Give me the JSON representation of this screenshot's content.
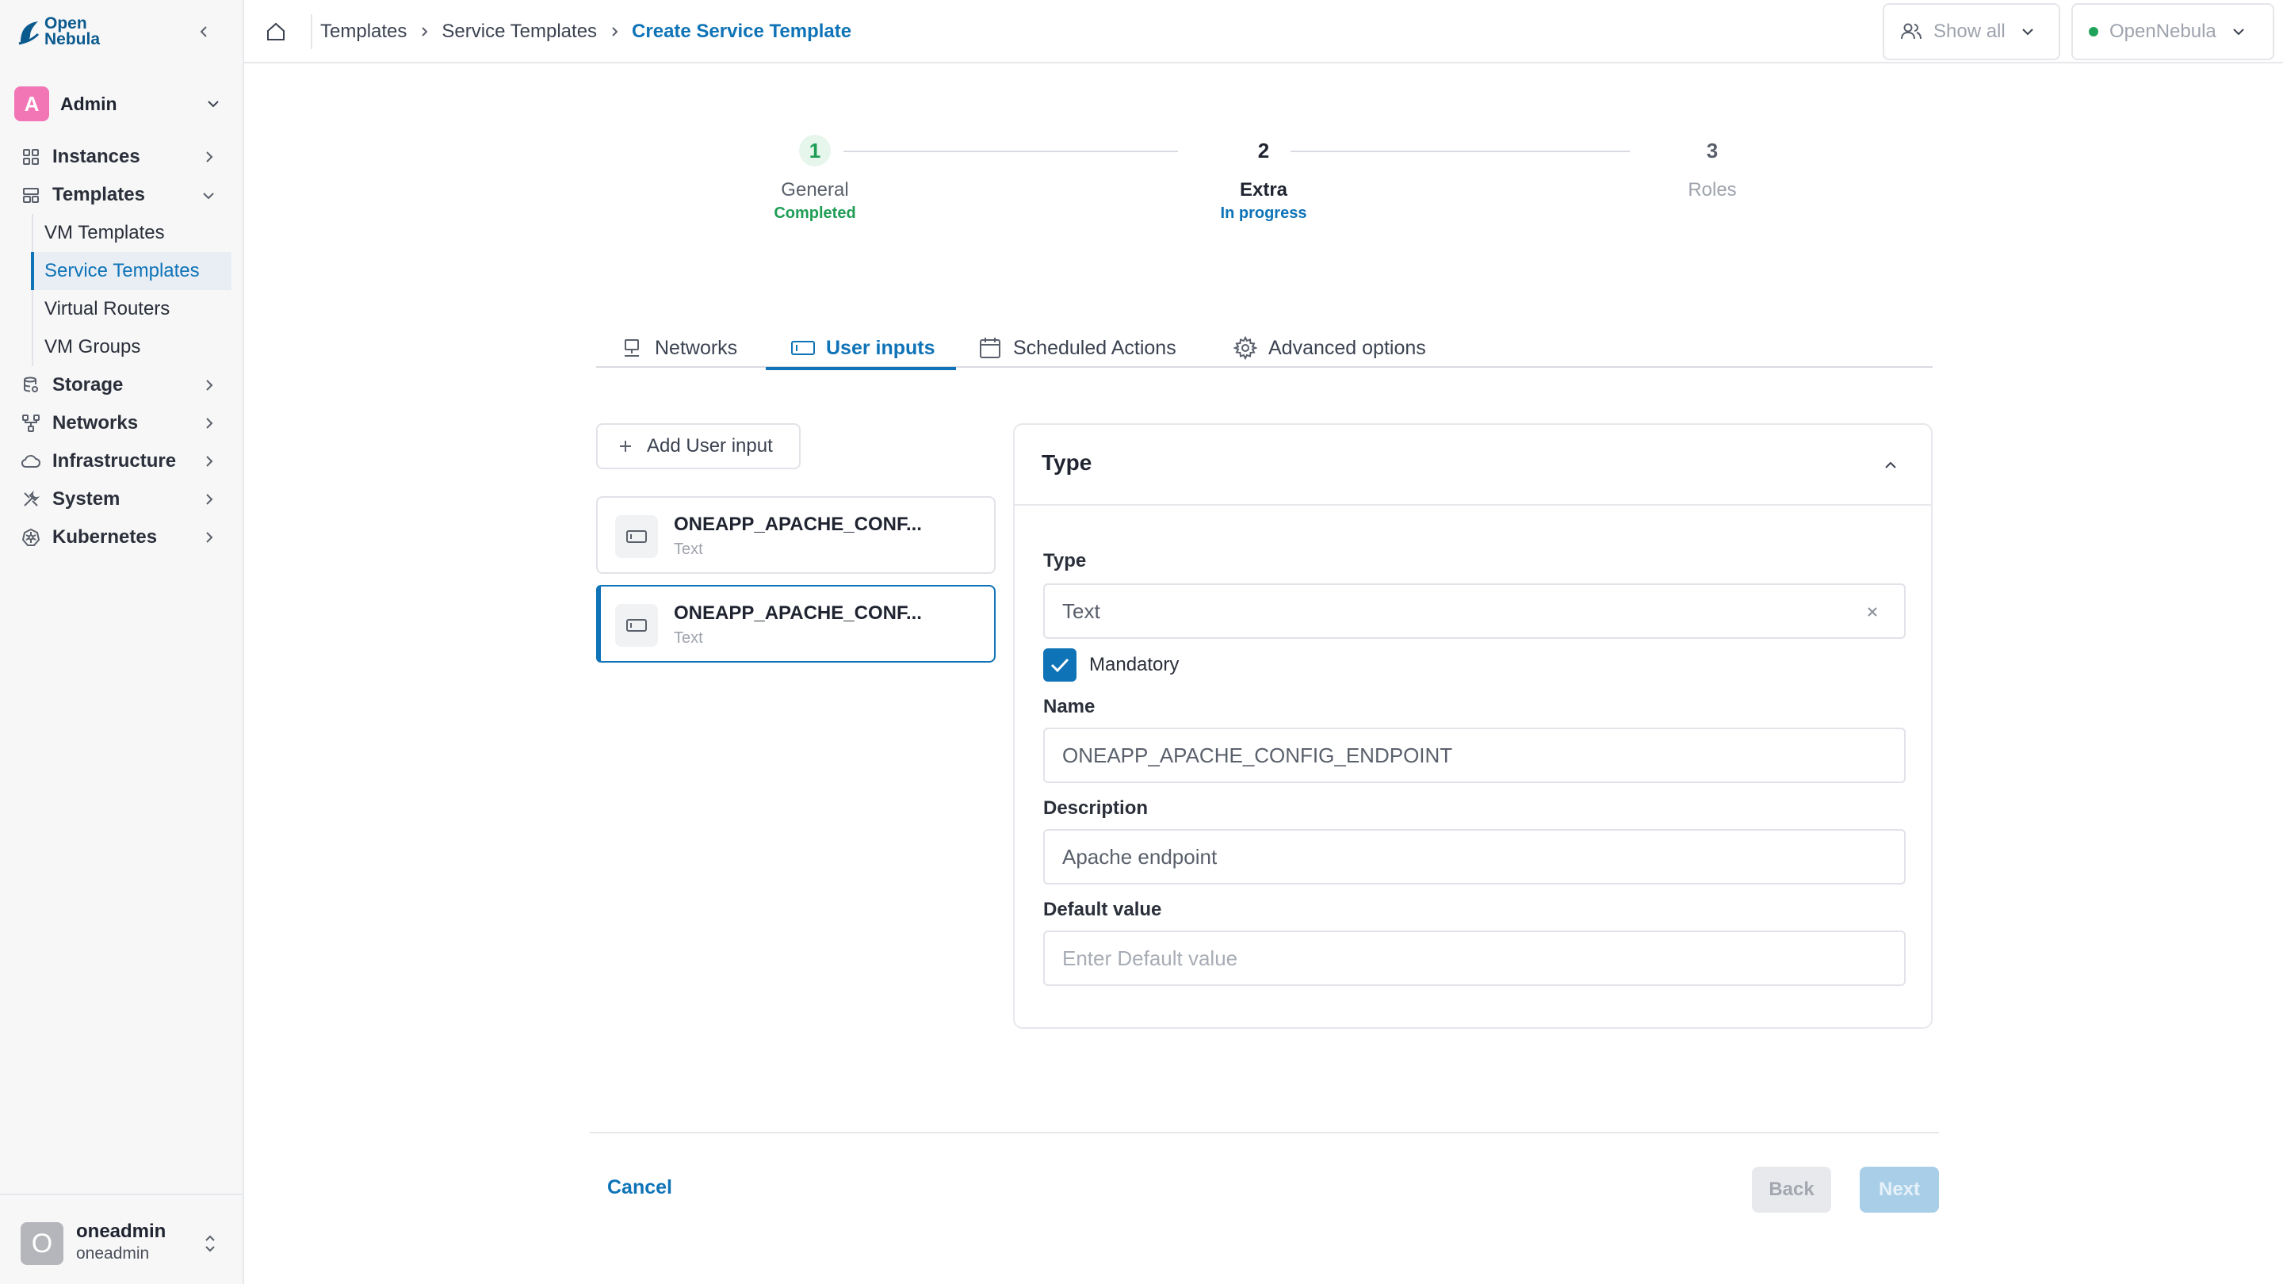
{
  "brand": {
    "logo_line1": "Open",
    "logo_line2": "Nebula",
    "accent": "#0e73b7",
    "success": "#1f9d55"
  },
  "sidebar": {
    "user": {
      "initial": "A",
      "name": "Admin"
    },
    "items": [
      {
        "label": "Instances",
        "icon": "instances-icon"
      },
      {
        "label": "Templates",
        "icon": "templates-icon",
        "expanded": true,
        "children": [
          {
            "label": "VM Templates"
          },
          {
            "label": "Service Templates",
            "active": true
          },
          {
            "label": "Virtual Routers"
          },
          {
            "label": "VM Groups"
          }
        ]
      },
      {
        "label": "Storage",
        "icon": "storage-icon"
      },
      {
        "label": "Networks",
        "icon": "networks-icon"
      },
      {
        "label": "Infrastructure",
        "icon": "cloud-icon"
      },
      {
        "label": "System",
        "icon": "tools-icon"
      },
      {
        "label": "Kubernetes",
        "icon": "kubernetes-icon"
      }
    ],
    "footer": {
      "initial": "O",
      "name": "oneadmin",
      "group": "oneadmin"
    }
  },
  "header": {
    "breadcrumb": [
      "Templates",
      "Service Templates",
      "Create Service Template"
    ],
    "filter_label": "Show all",
    "zone_label": "OpenNebula"
  },
  "stepper": {
    "steps": [
      {
        "number": "1",
        "title": "General",
        "status": "Completed"
      },
      {
        "number": "2",
        "title": "Extra",
        "status": "In progress"
      },
      {
        "number": "3",
        "title": "Roles",
        "status": ""
      }
    ]
  },
  "tabs": [
    {
      "label": "Networks",
      "icon": "network-icon"
    },
    {
      "label": "User inputs",
      "icon": "user-input-icon",
      "active": true
    },
    {
      "label": "Scheduled Actions",
      "icon": "calendar-icon"
    },
    {
      "label": "Advanced options",
      "icon": "gear-icon"
    }
  ],
  "user_inputs": {
    "add_label": "Add User input",
    "items": [
      {
        "title": "ONEAPP_APACHE_CONF...",
        "type": "Text"
      },
      {
        "title": "ONEAPP_APACHE_CONF...",
        "type": "Text",
        "selected": true
      }
    ]
  },
  "panel": {
    "title": "Type",
    "type_label": "Type",
    "type_value": "Text",
    "mandatory_label": "Mandatory",
    "name_label": "Name",
    "name_value": "ONEAPP_APACHE_CONFIG_ENDPOINT",
    "description_label": "Description",
    "description_value": "Apache endpoint",
    "default_label": "Default value",
    "default_placeholder": "Enter Default value"
  },
  "footer": {
    "cancel": "Cancel",
    "back": "Back",
    "next": "Next"
  }
}
